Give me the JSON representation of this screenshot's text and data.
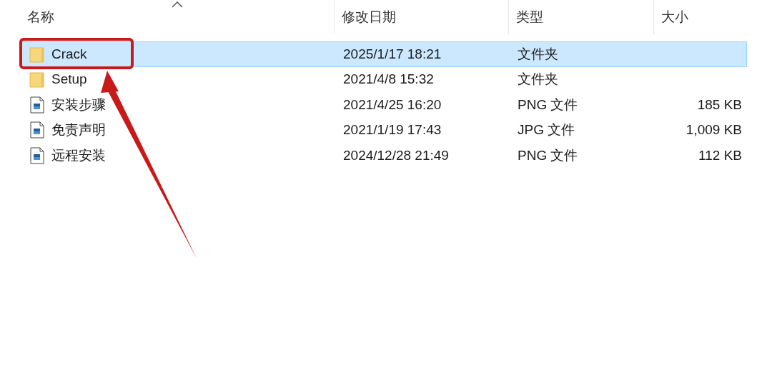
{
  "columns": [
    {
      "label": "名称",
      "sorted": true
    },
    {
      "label": "修改日期",
      "sorted": false
    },
    {
      "label": "类型",
      "sorted": false
    },
    {
      "label": "大小",
      "sorted": false
    }
  ],
  "rows": [
    {
      "kind": "folder",
      "name": "Crack",
      "date": "2025/1/17 18:21",
      "type": "文件夹",
      "selected": true
    },
    {
      "kind": "folder",
      "name": "Setup",
      "date": "2021/4/8 15:32",
      "type": "文件夹",
      "selected": false
    },
    {
      "kind": "image",
      "name": "安装步骤",
      "date": "2021/4/25 16:20",
      "type": "PNG 文件",
      "size": "185 KB",
      "selected": false
    },
    {
      "kind": "image",
      "name": "免责声明",
      "date": "2021/1/19 17:43",
      "type": "JPG 文件",
      "size": "1,009 KB",
      "selected": false
    },
    {
      "kind": "image",
      "name": "远程安装",
      "date": "2024/12/28 21:49",
      "type": "PNG 文件",
      "size": "112 KB",
      "selected": false
    }
  ]
}
